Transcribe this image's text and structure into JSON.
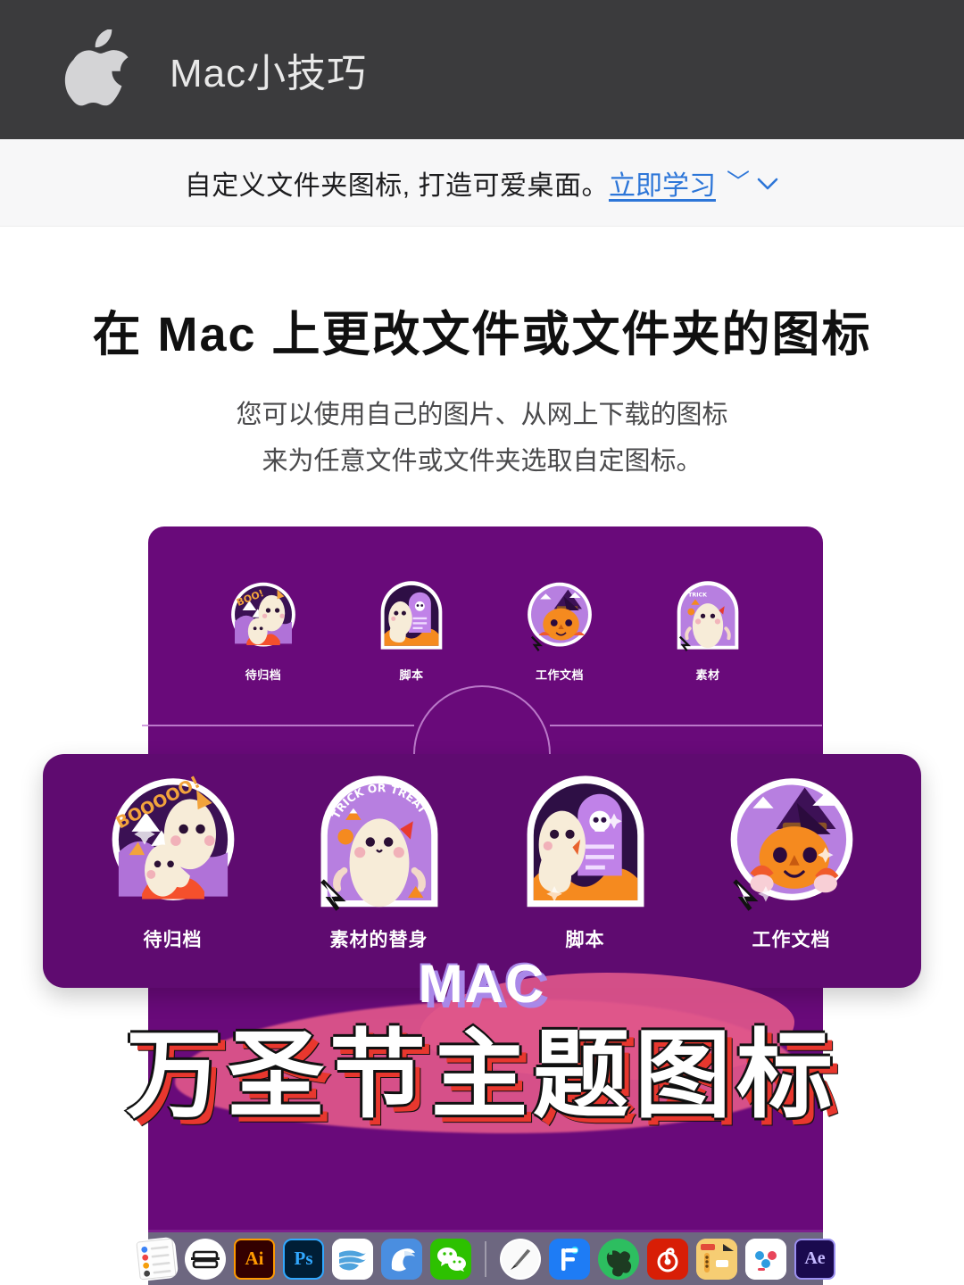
{
  "header": {
    "logo_icon": "apple-logo-icon",
    "title": "Mac小技巧",
    "background": "#3b3b3d"
  },
  "promo": {
    "text": "自定义文件夹图标, 打造可爱桌面。",
    "link_label": "立即学习",
    "chevron_icon": "chevron-down-icon",
    "link_color": "#2d76d8"
  },
  "hero": {
    "title": "在 Mac 上更改文件或文件夹的图标",
    "subtitle_line1": "您可以使用自己的图片、从网上下载的图标",
    "subtitle_line2": "来为任意文件或文件夹选取自定图标。"
  },
  "artwork": {
    "panel_back_color": "#690a7a",
    "panel_front_color": "#5f0b70",
    "blob_color": "#e0568b",
    "back_icons": [
      {
        "label": "待归档",
        "icon": "ghost-boooooo-icon",
        "shape": "circle"
      },
      {
        "label": "脚本",
        "icon": "ghost-tombstone-icon",
        "shape": "arch"
      },
      {
        "label": "工作文档",
        "icon": "pumpkin-witch-icon",
        "shape": "circle"
      },
      {
        "label": "素材",
        "icon": "ghost-trick-or-treat-icon",
        "shape": "arch"
      }
    ],
    "front_icons": [
      {
        "label": "待归档",
        "icon": "ghost-boooooo-icon",
        "shape": "circle"
      },
      {
        "label": "素材的替身",
        "icon": "ghost-trick-or-treat-icon",
        "shape": "arch"
      },
      {
        "label": "脚本",
        "icon": "ghost-tombstone-icon",
        "shape": "arch"
      },
      {
        "label": "工作文档",
        "icon": "pumpkin-witch-icon",
        "shape": "circle"
      }
    ],
    "banner_top": "MAC",
    "banner_main": "万圣节主题图标",
    "sticker_text_boo": "BOOOOO!",
    "sticker_text_trick": "TRICK OR TREAT"
  },
  "dock": {
    "background": "#6d6780",
    "items": [
      {
        "name": "notes-app-icon",
        "label": "Notes",
        "color": "#ffffff"
      },
      {
        "name": "mweb-app-icon",
        "label": "MWeb",
        "color": "#ffffff"
      },
      {
        "name": "illustrator-app-icon",
        "label": "Ai",
        "color": "#330000"
      },
      {
        "name": "photoshop-app-icon",
        "label": "Ps",
        "color": "#001e36"
      },
      {
        "name": "bear-app-icon",
        "label": "Ulysses",
        "color": "#ffffff"
      },
      {
        "name": "downie-app-icon",
        "label": "Downie",
        "color": "#4a8ee0"
      },
      {
        "name": "wechat-app-icon",
        "label": "WeChat",
        "color": "#2dc100"
      },
      {
        "name": "dock-separator",
        "label": "",
        "color": ""
      },
      {
        "name": "keynote-app-icon",
        "label": "Keynote",
        "color": "#ffffff"
      },
      {
        "name": "feishu-app-icon",
        "label": "Feishu",
        "color": "#1e7cf5"
      },
      {
        "name": "evernote-app-icon",
        "label": "Evernote",
        "color": "#2dbe60"
      },
      {
        "name": "netease-music-icon",
        "label": "NetEase Music",
        "color": "#d81e06"
      },
      {
        "name": "folder-app-icon",
        "label": "Folder",
        "color": "#f5c869"
      },
      {
        "name": "baidu-netdisk-icon",
        "label": "Baidu Netdisk",
        "color": "#ffffff"
      },
      {
        "name": "aftereffects-app-icon",
        "label": "Ae",
        "color": "#1a0a4e"
      }
    ]
  }
}
